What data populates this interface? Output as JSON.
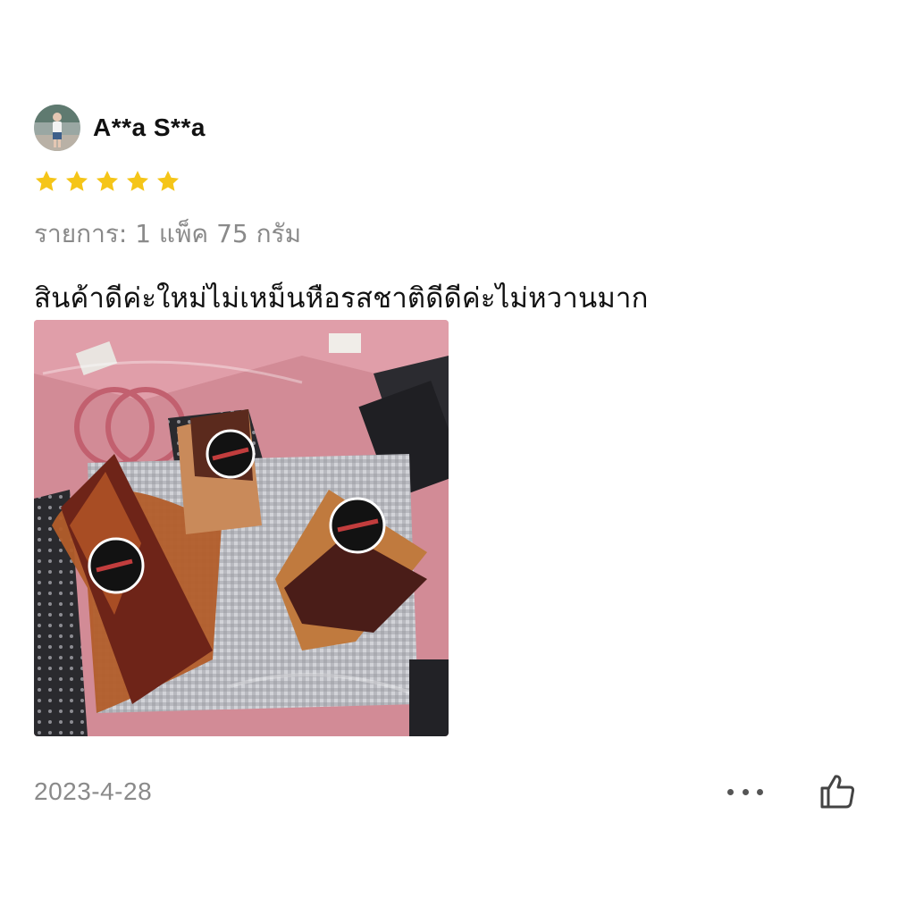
{
  "review": {
    "username": "A**a S**a",
    "rating": 5,
    "rating_max": 5,
    "star_color": "#F5C518",
    "variant": "รายการ: 1 แพ็ค 75 กรัม",
    "text": "สินค้าดีค่ะใหม่ไม่เหม็นหือรสชาติดีดีค่ะไม่หวานมาก",
    "date": "2023-4-28"
  },
  "icons": {
    "avatar": "user-avatar",
    "star": "star-icon",
    "more": "more-icon",
    "like": "thumbs-up-icon"
  }
}
